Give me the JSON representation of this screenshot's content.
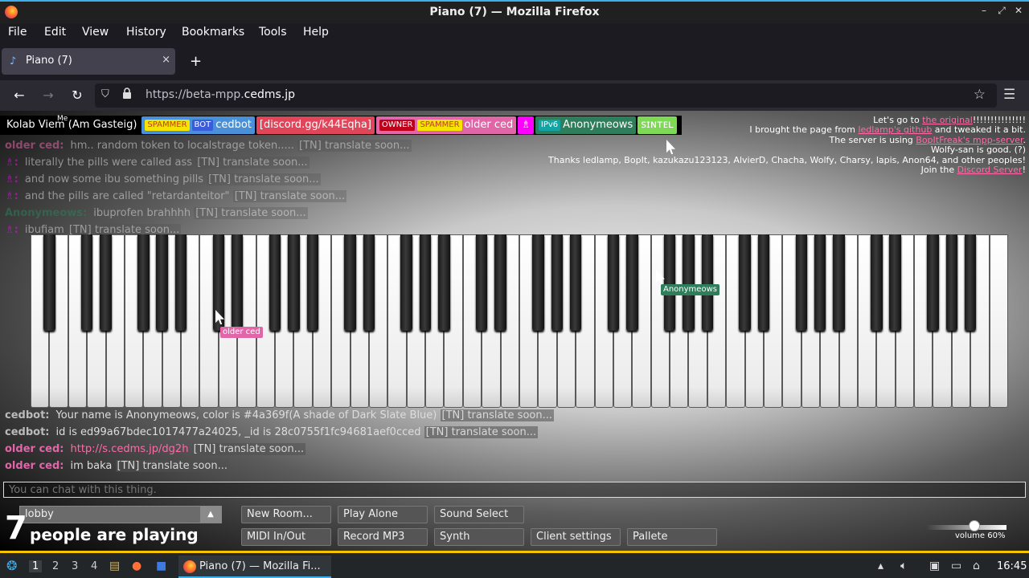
{
  "window": {
    "title": "Piano (7) — Mozilla Firefox"
  },
  "menu": [
    "File",
    "Edit",
    "View",
    "History",
    "Bookmarks",
    "Tools",
    "Help"
  ],
  "tab": {
    "title": "Piano (7)",
    "close": "×",
    "new": "+"
  },
  "url": {
    "prefix": "https://beta-mpp.",
    "domain": "cedms.jp"
  },
  "users": {
    "me_label": "Me",
    "list": [
      {
        "name": "Kolab Viem (Am Gasteig)",
        "color": "#000000",
        "tags": []
      },
      {
        "name": "cedbot",
        "color": "#4a90d9",
        "tags": [
          {
            "text": "SPAMMER",
            "bg": "#f5e400",
            "fg": "#c0392b"
          },
          {
            "text": "BOT",
            "bg": "#3b5cd9",
            "fg": "#ffffff"
          }
        ]
      },
      {
        "name": "[discord.gg/k44Eqha]",
        "color": "#e0455a",
        "tags": []
      },
      {
        "name": "older ced",
        "color": "#e066a8",
        "tags": [
          {
            "text": "OWNER",
            "bg": "#c0001a",
            "fg": "#ffffff"
          },
          {
            "text": "SPAMMER",
            "bg": "#f5e400",
            "fg": "#c0392b"
          }
        ]
      },
      {
        "name": "♗",
        "color": "#ff00ff",
        "tags": []
      },
      {
        "name": "Anonymeows",
        "color": "#2e7d5b",
        "tags": [
          {
            "text": "IPv6",
            "bg": "#13a3a3",
            "fg": "#ffffff"
          }
        ]
      },
      {
        "name": "ꜱɪɴᴛᴇʟ",
        "color": "#7ed957",
        "tags": []
      }
    ]
  },
  "credits": {
    "line1_pre": "Let's go to ",
    "line1_link": "the original",
    "line1_post": "!!!!!!!!!!!!!!!",
    "line2_pre": "I brought the page from ",
    "line2_link": "ledlamp's github",
    "line2_post": " and tweaked it a bit.",
    "line3_pre": "The server is using ",
    "line3_link": "BopItFreak's mpp-server",
    "line3_post": ".",
    "line4": "Wolfy-san is good. (?)",
    "line5": "Thanks ledlamp, BopIt, kazukazu123123, AlvierD, Chacha, Wolfy, Charsy, lapis, Anon64, and other peoples!",
    "line6_pre": "Join the ",
    "line6_link": "Discord Server",
    "line6_post": "!"
  },
  "oldchat": [
    {
      "name": "older ced:",
      "color": "#e066a8",
      "msg": "hm.. random token to localstrage token.....",
      "tr": "[TN] translate soon..."
    },
    {
      "name": "♗:",
      "color": "#ff00ff",
      "msg": "literally the pills were called ass",
      "tr": "[TN] translate soon..."
    },
    {
      "name": "♗:",
      "color": "#ff00ff",
      "msg": "and now some ibu something pills",
      "tr": "[TN] translate soon..."
    },
    {
      "name": "♗:",
      "color": "#ff00ff",
      "msg": "and the pills are called \"retardanteitor\"",
      "tr": "[TN] translate soon..."
    },
    {
      "name": "Anonymeows:",
      "color": "#2e7d5b",
      "msg": "ibuprofen brahhhh",
      "tr": "[TN] translate soon..."
    },
    {
      "name": "♗:",
      "color": "#ff00ff",
      "msg": "ibufiam",
      "tr": "[TN] translate soon..."
    }
  ],
  "chat": [
    {
      "name": "cedbot:",
      "color": "#bbbbbb",
      "msg": "Your name is Anonymeows, color is #4a369f(A shade of Dark Slate Blue)",
      "tr": "[TN] translate soon...",
      "link": ""
    },
    {
      "name": "cedbot:",
      "color": "#bbbbbb",
      "msg": "id is ed99a67bdec1017477a24025, _id is 28c0755f1fc94681aef0cced",
      "tr": "[TN] translate soon...",
      "link": ""
    },
    {
      "name": "older ced:",
      "color": "#e066a8",
      "msg": "",
      "tr": "[TN] translate soon...",
      "link": "http://s.cedms.jp/dg2h"
    },
    {
      "name": "older ced:",
      "color": "#e066a8",
      "msg": "im baka",
      "tr": "[TN] translate soon...",
      "link": ""
    }
  ],
  "cursors": [
    {
      "name": "older ced",
      "color": "#e066a8"
    },
    {
      "name": "Anonymeows",
      "color": "#2e7d5b"
    }
  ],
  "chat_input": {
    "placeholder": "You can chat with this thing."
  },
  "status": {
    "count": "7",
    "label": "people are playing"
  },
  "room": {
    "value": "lobby"
  },
  "buttons": {
    "new_room": "New Room...",
    "play_alone": "Play Alone",
    "sound_select": "Sound Select",
    "midi": "MIDI In/Out",
    "record": "Record MP3",
    "synth": "Synth",
    "client_settings": "Client settings",
    "pallete": "Pallete"
  },
  "volume": {
    "label": "volume 60%",
    "level": 0.6
  },
  "taskbar": {
    "workspaces": [
      "1",
      "2",
      "3",
      "4"
    ],
    "app_title": "Piano (7) — Mozilla Fi...",
    "clock": "16:45"
  }
}
